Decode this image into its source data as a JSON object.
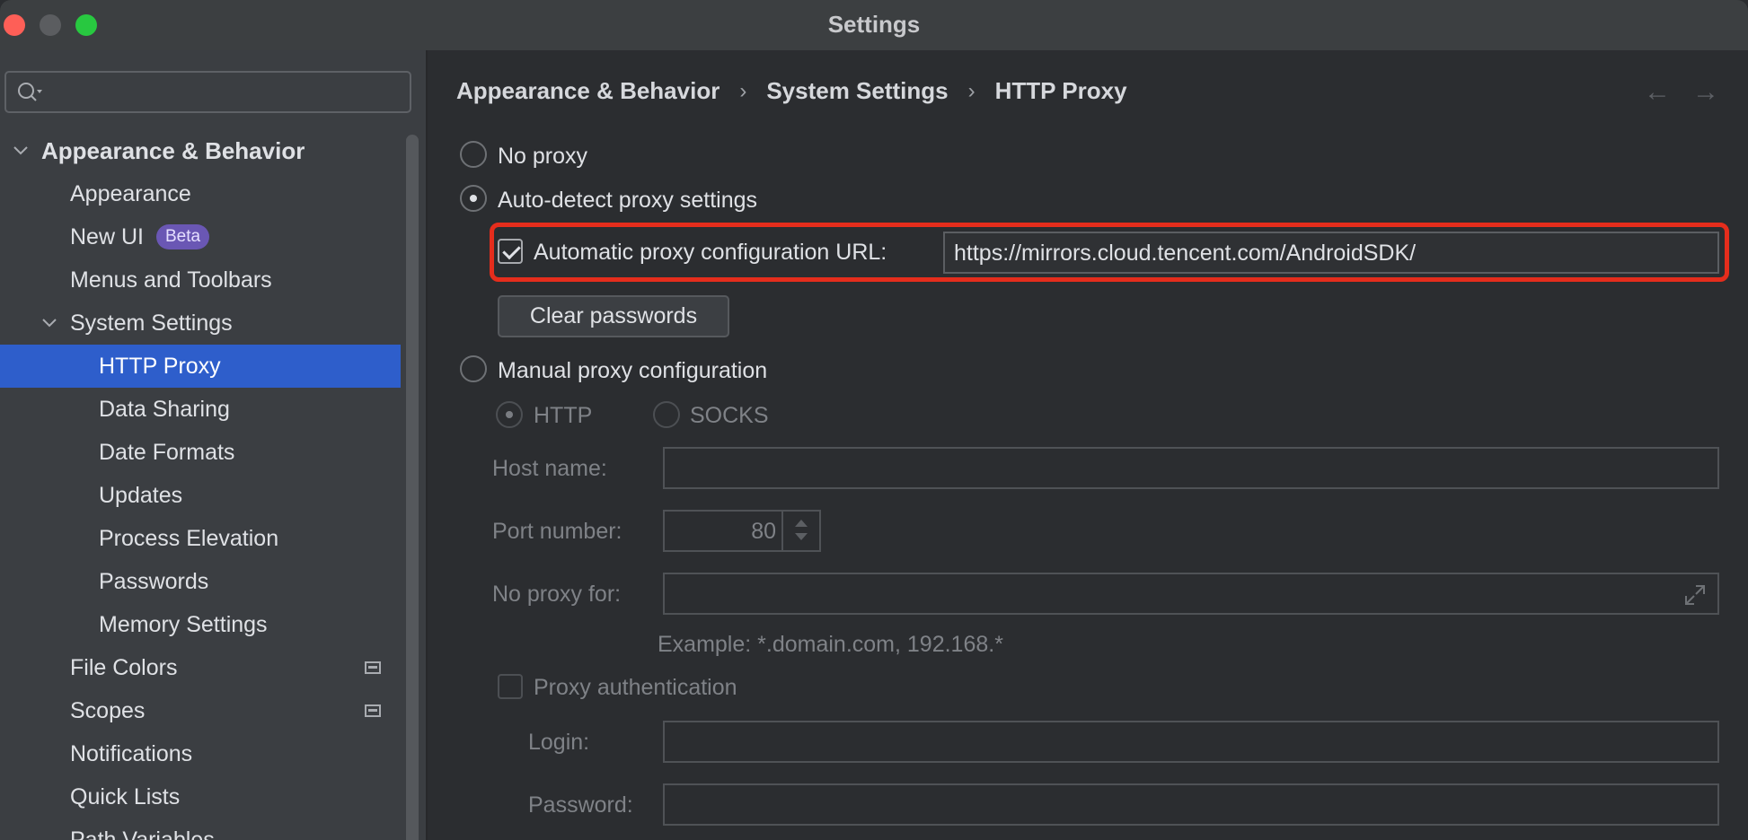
{
  "window": {
    "title": "Settings"
  },
  "sidebar": {
    "search_placeholder": "",
    "items": [
      {
        "label": "Appearance & Behavior",
        "level": 0,
        "expanded": true
      },
      {
        "label": "Appearance",
        "level": 1
      },
      {
        "label": "New UI",
        "level": 1,
        "badge": "Beta"
      },
      {
        "label": "Menus and Toolbars",
        "level": 1
      },
      {
        "label": "System Settings",
        "level": 1,
        "expanded": true
      },
      {
        "label": "HTTP Proxy",
        "level": 2,
        "selected": true
      },
      {
        "label": "Data Sharing",
        "level": 2
      },
      {
        "label": "Date Formats",
        "level": 2
      },
      {
        "label": "Updates",
        "level": 2
      },
      {
        "label": "Process Elevation",
        "level": 2
      },
      {
        "label": "Passwords",
        "level": 2
      },
      {
        "label": "Memory Settings",
        "level": 2
      },
      {
        "label": "File Colors",
        "level": 1,
        "icon": "scope-icon"
      },
      {
        "label": "Scopes",
        "level": 1,
        "icon": "scope-icon"
      },
      {
        "label": "Notifications",
        "level": 1
      },
      {
        "label": "Quick Lists",
        "level": 1
      },
      {
        "label": "Path Variables",
        "level": 1
      }
    ]
  },
  "breadcrumb": [
    "Appearance & Behavior",
    "System Settings",
    "HTTP Proxy"
  ],
  "proxy": {
    "no_proxy_label": "No proxy",
    "auto_detect_label": "Auto-detect proxy settings",
    "auto_url_label": "Automatic proxy configuration URL:",
    "auto_url_value": "https://mirrors.cloud.tencent.com/AndroidSDK/",
    "clear_passwords_label": "Clear passwords",
    "manual_label": "Manual proxy configuration",
    "http_label": "HTTP",
    "socks_label": "SOCKS",
    "host_label": "Host name:",
    "host_value": "",
    "port_label": "Port number:",
    "port_value": "80",
    "no_proxy_for_label": "No proxy for:",
    "no_proxy_for_value": "",
    "example_text": "Example: *.domain.com, 192.168.*",
    "auth_label": "Proxy authentication",
    "login_label": "Login:",
    "login_value": "",
    "password_label": "Password:",
    "password_value": ""
  },
  "colors": {
    "accent": "#2e5ecb",
    "highlight": "#e52d1c",
    "badge": "#6a57b4"
  }
}
